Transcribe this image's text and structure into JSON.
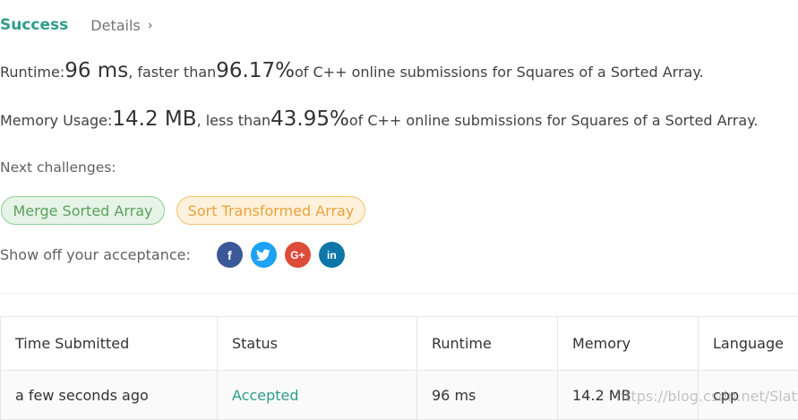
{
  "header": {
    "status": "Success",
    "details_label": "Details",
    "details_chevron": "›"
  },
  "runtime": {
    "label": "Runtime: ",
    "value": "96 ms",
    "mid": ", faster than ",
    "percent": "96.17%",
    "tail": " of C++ online submissions for Squares of a Sorted Array."
  },
  "memory": {
    "label": "Memory Usage: ",
    "value": "14.2 MB",
    "mid": ", less than ",
    "percent": "43.95%",
    "tail": " of C++ online submissions for Squares of a Sorted Array."
  },
  "next": {
    "label": "Next challenges:",
    "challenges": [
      "Merge Sorted Array",
      "Sort Transformed Array"
    ]
  },
  "share": {
    "label": "Show off your acceptance:",
    "icons": [
      "facebook-icon",
      "twitter-icon",
      "google-plus-icon",
      "linkedin-icon"
    ],
    "glyphs": {
      "facebook": "f",
      "twitter": "t",
      "google": "G+",
      "linkedin": "in"
    }
  },
  "table": {
    "headers": [
      "Time Submitted",
      "Status",
      "Runtime",
      "Memory",
      "Language"
    ],
    "rows": [
      [
        "a few seconds ago",
        "Accepted",
        "96 ms",
        "14.2 MB",
        "cpp"
      ]
    ]
  },
  "watermark": "https://blog.csdn.net/Slatter",
  "colors": {
    "success": "#2e9e88",
    "tag_green": "#5ba25f",
    "tag_orange": "#e8a33d"
  }
}
